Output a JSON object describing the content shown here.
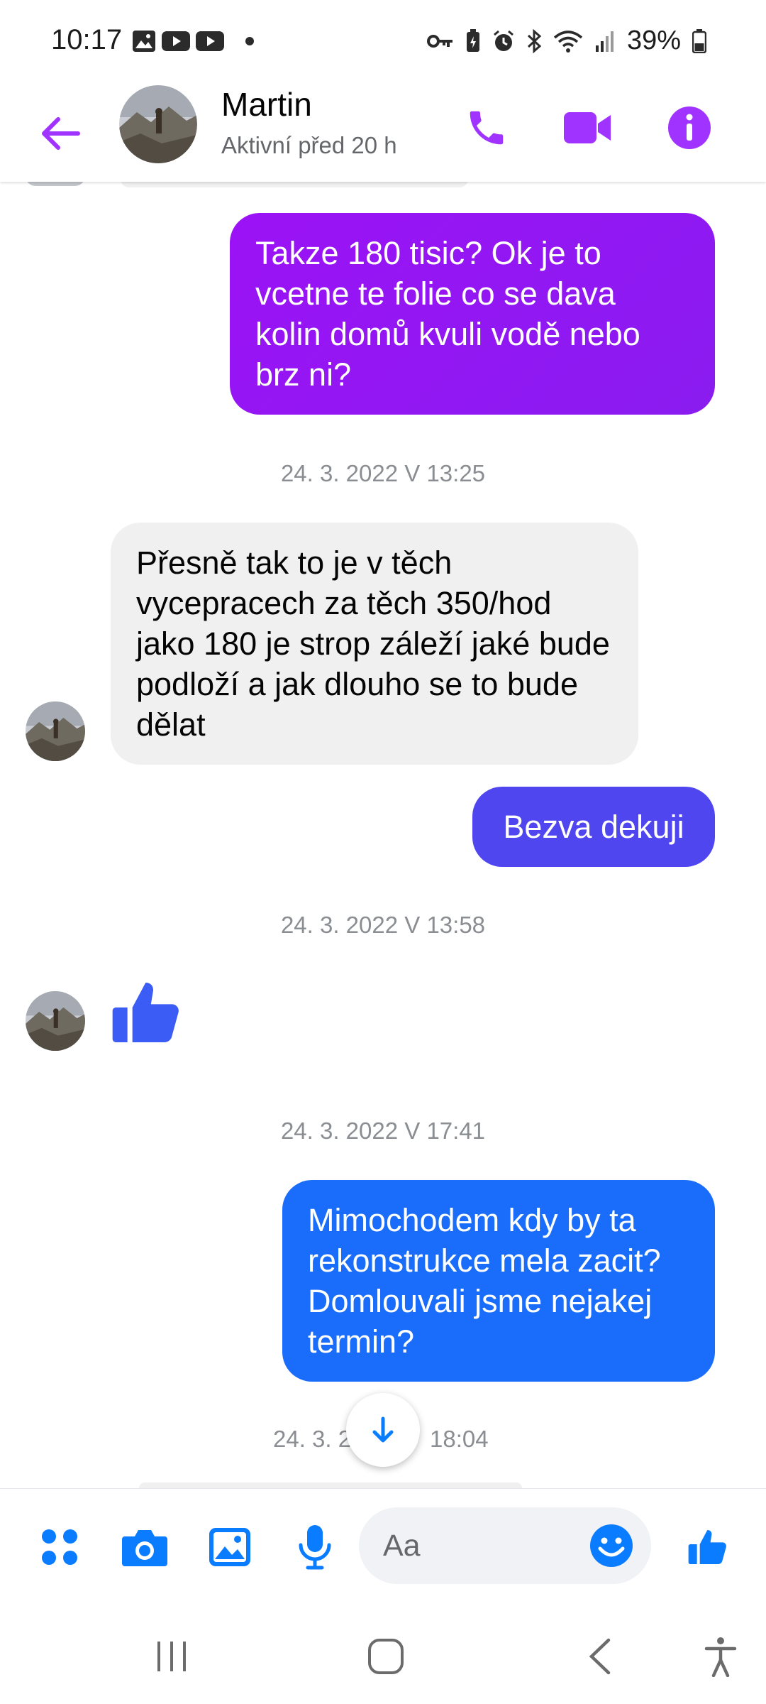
{
  "status_bar": {
    "time": "10:17",
    "battery": "39%",
    "left_icons": [
      "gallery-icon",
      "youtube-icon",
      "youtube-icon",
      "dot-icon"
    ],
    "right_icons": [
      "vpn-key-icon",
      "battery-saver-icon",
      "alarm-icon",
      "bluetooth-icon",
      "wifi-icon",
      "signal-icon",
      "battery-icon"
    ]
  },
  "header": {
    "name": "Martin",
    "status": "Aktivní před 20 h",
    "accent_color": "#a033ff",
    "icons": [
      "back-arrow-icon",
      "phone-icon",
      "video-camera-icon",
      "info-icon"
    ]
  },
  "messages": {
    "m1": "Takze 180 tisic? Ok je to vcetne te folie co se dava kolin domů kvuli vodě nebo brz ni?",
    "ts1": "24. 3. 2022 V 13:25",
    "m2": "Přesně tak to je v těch vycepracech za těch 350/hod jako 180 je strop záleží jaké bude podloží a jak dlouho se to bude dělat",
    "m3": "Bezva dekuji",
    "ts2": "24. 3. 2022 V 13:58",
    "ts3": "24. 3. 2022 V 17:41",
    "m4": "Mimochodem kdy by ta rekonstrukce mela zacit? Domlouvali jsme nejakej termin?",
    "ts4_left": "24. 3. 2",
    "ts4_right": "18:04"
  },
  "bubble_colors": {
    "m1": "#9b12f5",
    "m3": "#5046f0",
    "m4": "#1a6dfb",
    "incoming": "#f0f0f0",
    "like": "#3b5cf5"
  },
  "composer": {
    "placeholder": "Aa",
    "icons": [
      "apps-icon",
      "camera-icon",
      "image-icon",
      "microphone-icon",
      "emoji-icon",
      "thumbs-up-icon"
    ],
    "accent_color": "#0a7cff"
  },
  "navbar": {
    "icons": [
      "recent-apps-icon",
      "home-icon",
      "back-icon",
      "accessibility-icon"
    ]
  }
}
